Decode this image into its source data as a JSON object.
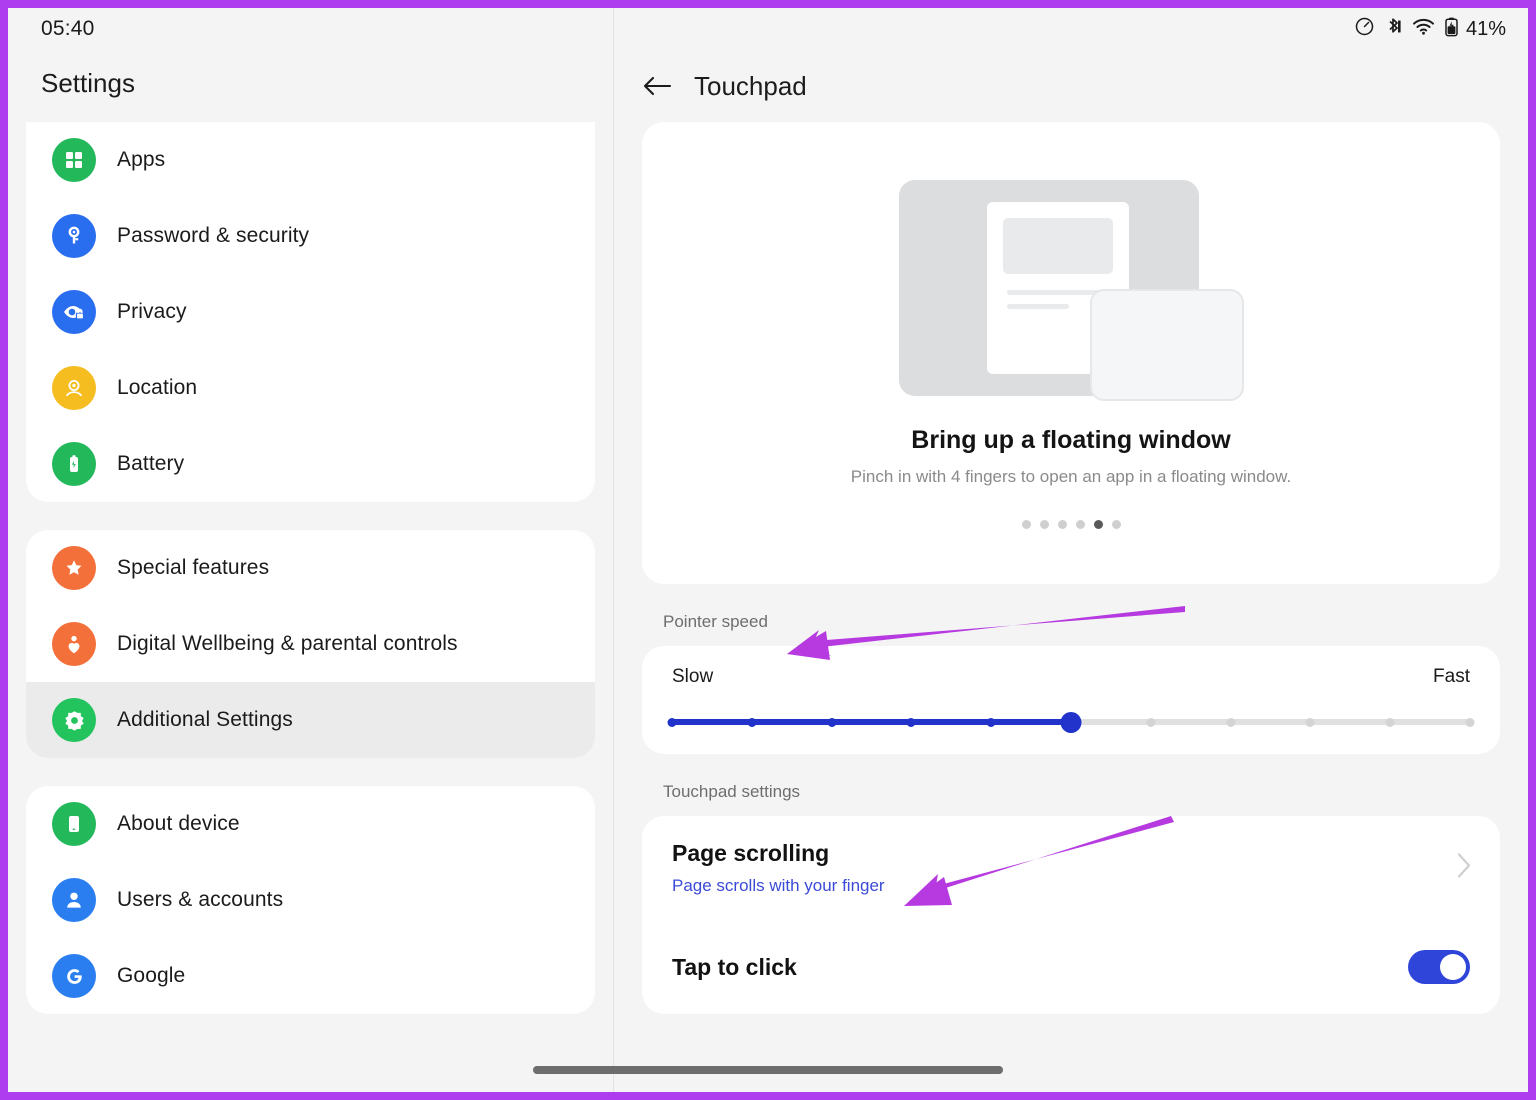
{
  "frame": {
    "border_color": "#ae3df0"
  },
  "statusbar": {
    "clock": "05:40",
    "battery_percent": "41%",
    "icons": [
      "data-saver-icon",
      "bluetooth-icon",
      "wifi-icon",
      "battery-icon"
    ]
  },
  "sidebar": {
    "title": "Settings",
    "groups": [
      {
        "items": [
          {
            "label": "Apps",
            "icon": "apps-grid-icon",
            "color": "#23b95b",
            "selected": false
          },
          {
            "label": "Password & security",
            "icon": "key-icon",
            "color": "#2a6ef0",
            "selected": false
          },
          {
            "label": "Privacy",
            "icon": "privacy-eye-lock-icon",
            "color": "#2a6ef0",
            "selected": false
          },
          {
            "label": "Location",
            "icon": "location-pin-icon",
            "color": "#f5bd20",
            "selected": false
          },
          {
            "label": "Battery",
            "icon": "battery-bolt-icon",
            "color": "#23b95b",
            "selected": false
          }
        ]
      },
      {
        "items": [
          {
            "label": "Special features",
            "icon": "star-icon",
            "color": "#f4703a",
            "selected": false
          },
          {
            "label": "Digital Wellbeing & parental controls",
            "icon": "wellbeing-icon",
            "color": "#f4703a",
            "selected": false
          },
          {
            "label": "Additional Settings",
            "icon": "gear-icon",
            "color": "#23c45e",
            "selected": true
          }
        ]
      },
      {
        "items": [
          {
            "label": "About device",
            "icon": "phone-icon",
            "color": "#23b95b",
            "selected": false
          },
          {
            "label": "Users & accounts",
            "icon": "person-icon",
            "color": "#2a7ef0",
            "selected": false
          },
          {
            "label": "Google",
            "icon": "google-g-icon",
            "color": "#2a7ef0",
            "selected": false
          }
        ]
      }
    ]
  },
  "detail": {
    "back_icon": "back-arrow-icon",
    "title": "Touchpad",
    "hero": {
      "illustration": "floating-window-illustration",
      "title": "Bring up a floating window",
      "subtitle": "Pinch in with 4 fingers to open an app in a floating window.",
      "dots_total": 6,
      "dots_active_index": 4
    },
    "pointer_speed": {
      "section_label": "Pointer speed",
      "min_label": "Slow",
      "max_label": "Fast",
      "ticks": 11,
      "value_index": 5
    },
    "touchpad_settings": {
      "section_label": "Touchpad settings",
      "rows": [
        {
          "title": "Page scrolling",
          "subtitle": "Page scrolls with your finger",
          "control": "chevron-right-icon"
        },
        {
          "title": "Tap to click",
          "control": "toggle",
          "toggle_on": true,
          "toggle_color": "#2f44d8"
        }
      ]
    }
  },
  "annotations": {
    "color": "#b63ae0",
    "arrows": [
      {
        "name": "arrow-to-pointer-speed",
        "target": "Pointer speed"
      },
      {
        "name": "arrow-to-page-scrolling",
        "target": "Page scrolling"
      }
    ]
  }
}
